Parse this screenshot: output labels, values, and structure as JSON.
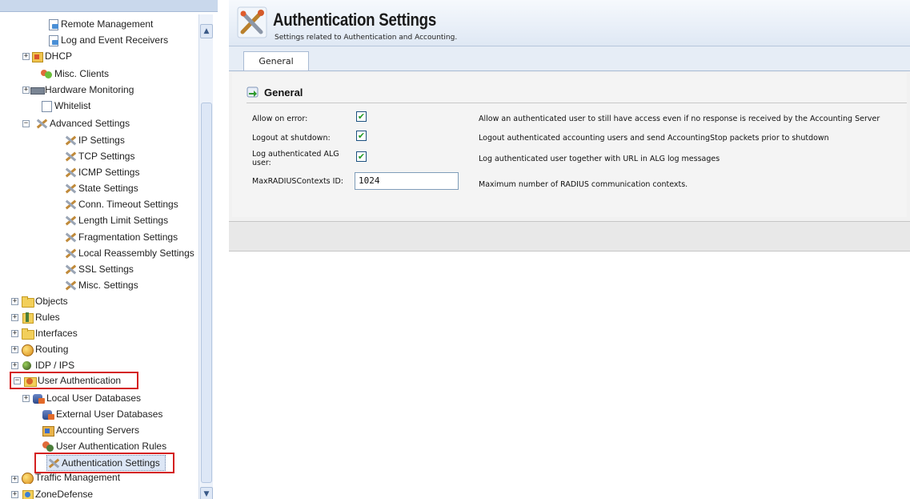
{
  "tree": {
    "items": [
      {
        "label": "Remote Management",
        "icon": "page-icon"
      },
      {
        "label": "Log and Event Receivers",
        "icon": "page-icon"
      },
      {
        "label": "DHCP",
        "icon": "dhcp-icon"
      },
      {
        "label": "Misc. Clients",
        "icon": "clients-icon"
      },
      {
        "label": "Hardware Monitoring",
        "icon": "hardware-icon"
      },
      {
        "label": "Whitelist",
        "icon": "whitelist-icon"
      },
      {
        "label": "Advanced Settings",
        "icon": "tools-icon"
      },
      {
        "label": "IP Settings",
        "icon": "tools-icon"
      },
      {
        "label": "TCP Settings",
        "icon": "tools-icon"
      },
      {
        "label": "ICMP Settings",
        "icon": "tools-icon"
      },
      {
        "label": "State Settings",
        "icon": "tools-icon"
      },
      {
        "label": "Conn. Timeout Settings",
        "icon": "tools-icon"
      },
      {
        "label": "Length Limit Settings",
        "icon": "tools-icon"
      },
      {
        "label": "Fragmentation Settings",
        "icon": "tools-icon"
      },
      {
        "label": "Local Reassembly Settings",
        "icon": "tools-icon"
      },
      {
        "label": "SSL Settings",
        "icon": "tools-icon"
      },
      {
        "label": "Misc. Settings",
        "icon": "tools-icon"
      },
      {
        "label": "Objects",
        "icon": "folder-icon"
      },
      {
        "label": "Rules",
        "icon": "rules-icon"
      },
      {
        "label": "Interfaces",
        "icon": "folder-icon"
      },
      {
        "label": "Routing",
        "icon": "globe-icon"
      },
      {
        "label": "IDP / IPS",
        "icon": "idp-icon"
      },
      {
        "label": "User Authentication",
        "icon": "user-auth-icon"
      },
      {
        "label": "Local User Databases",
        "icon": "database-icon"
      },
      {
        "label": "External User Databases",
        "icon": "database-icon"
      },
      {
        "label": "Accounting Servers",
        "icon": "accounting-icon"
      },
      {
        "label": "User Authentication Rules",
        "icon": "users-icon"
      },
      {
        "label": "Authentication Settings",
        "icon": "tools-icon"
      },
      {
        "label": "Traffic Management",
        "icon": "globe-icon"
      },
      {
        "label": "ZoneDefense",
        "icon": "zone-icon"
      }
    ]
  },
  "header": {
    "title": "Authentication Settings",
    "subtitle": "Settings related to Authentication and Accounting."
  },
  "tabs": [
    {
      "label": "General",
      "active": true
    }
  ],
  "section": {
    "title": "General"
  },
  "settings": [
    {
      "label": "Allow on error:",
      "checked": true,
      "description": "Allow an authenticated user to still have access even if no response is received by the Accounting Server"
    },
    {
      "label": "Logout at shutdown:",
      "checked": true,
      "description": "Logout authenticated accounting users and send AccountingStop packets prior to shutdown"
    },
    {
      "label": "Log authenticated ALG user:",
      "checked": true,
      "description": "Log authenticated user together with URL in ALG log messages"
    },
    {
      "label": "MaxRADIUSContexts ID:",
      "value": "1024",
      "description": "Maximum number of RADIUS communication contexts."
    }
  ],
  "colors": {
    "highlight_box": "#d42020",
    "header_bg": "#dfe8f4",
    "check_mark": "#219a21"
  }
}
